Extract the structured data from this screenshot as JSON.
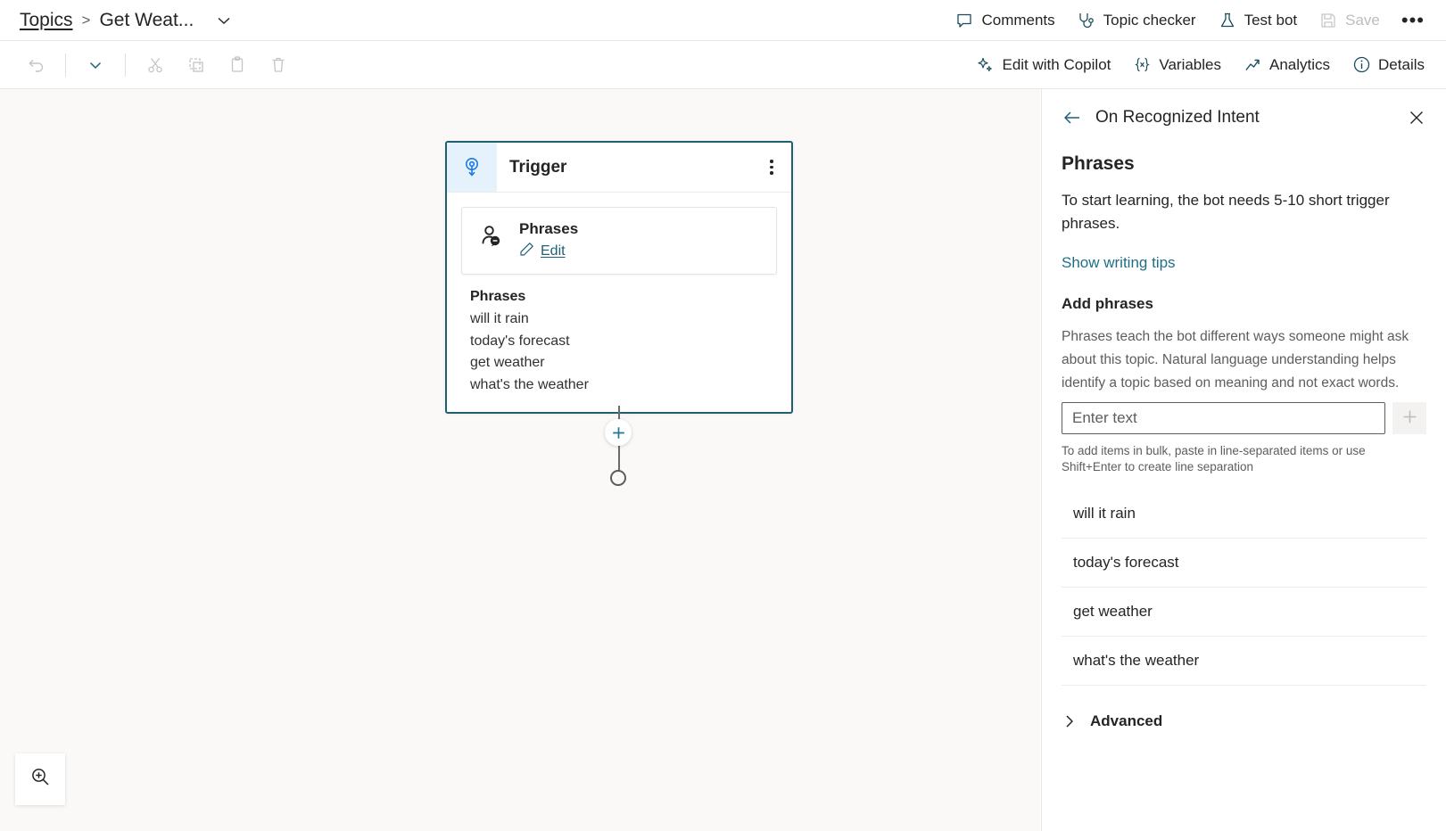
{
  "breadcrumb": {
    "root_label": "Topics",
    "separator": ">",
    "current_label": "Get Weat...",
    "chevron_icon": "chevron-down-icon"
  },
  "topbar": {
    "actions": [
      {
        "label": "Comments",
        "icon": "comment-icon",
        "disabled": false
      },
      {
        "label": "Topic checker",
        "icon": "stethoscope-icon",
        "disabled": false
      },
      {
        "label": "Test bot",
        "icon": "flask-icon",
        "disabled": false
      },
      {
        "label": "Save",
        "icon": "save-disk-icon",
        "disabled": true
      }
    ],
    "overflow_label": "•••"
  },
  "toolbar": {
    "left_tools": [
      {
        "name": "undo-icon",
        "disabled": true
      },
      {
        "name": "chevron-down-icon",
        "disabled": false
      },
      {
        "name": "cut-icon",
        "disabled": true
      },
      {
        "name": "copy-icon",
        "disabled": true
      },
      {
        "name": "paste-icon",
        "disabled": true
      },
      {
        "name": "delete-icon",
        "disabled": true
      }
    ],
    "right_actions": [
      {
        "label": "Edit with Copilot",
        "icon": "sparkle-icon"
      },
      {
        "label": "Variables",
        "icon": "variables-braces-icon"
      },
      {
        "label": "Analytics",
        "icon": "trend-chart-icon"
      },
      {
        "label": "Details",
        "icon": "info-circle-icon"
      }
    ]
  },
  "canvas": {
    "node": {
      "icon": "trigger-signal-icon",
      "title": "Trigger",
      "menu_icon": "more-vertical-icon",
      "subcard": {
        "icon": "person-speech-icon",
        "title": "Phrases",
        "edit_label": "Edit",
        "edit_icon": "pencil-icon"
      },
      "phrases_heading": "Phrases",
      "phrases": [
        "will it rain",
        "today's forecast",
        "get weather",
        "what's the weather"
      ]
    },
    "connector": {
      "add_icon": "plus-circle-icon",
      "end_icon": "end-node-circle"
    },
    "zoom_control": {
      "icon": "zoom-in-icon"
    }
  },
  "panel": {
    "back_icon": "arrow-left-icon",
    "header_title": "On Recognized Intent",
    "close_icon": "close-icon",
    "title": "Phrases",
    "description": "To start learning, the bot needs 5-10 short trigger phrases.",
    "writing_tips_link": "Show writing tips",
    "add_phrases_heading": "Add phrases",
    "add_phrases_note": "Phrases teach the bot different ways someone might ask about this topic. Natural language understanding helps identify a topic based on meaning and not exact words.",
    "input": {
      "placeholder": "Enter text",
      "value": "",
      "add_button_icon": "plus-icon"
    },
    "bulk_note": "To add items in bulk, paste in line-separated items or use Shift+Enter to create line separation",
    "phrases": [
      "will it rain",
      "today's forecast",
      "get weather",
      "what's the weather"
    ],
    "advanced": {
      "label": "Advanced",
      "chevron_icon": "chevron-right-icon"
    }
  },
  "colors": {
    "accent_teal": "#1f5f7a",
    "node_border": "#1f5f6e",
    "trigger_blue": "#1b7ae0",
    "canvas_bg": "#faf9f8"
  }
}
